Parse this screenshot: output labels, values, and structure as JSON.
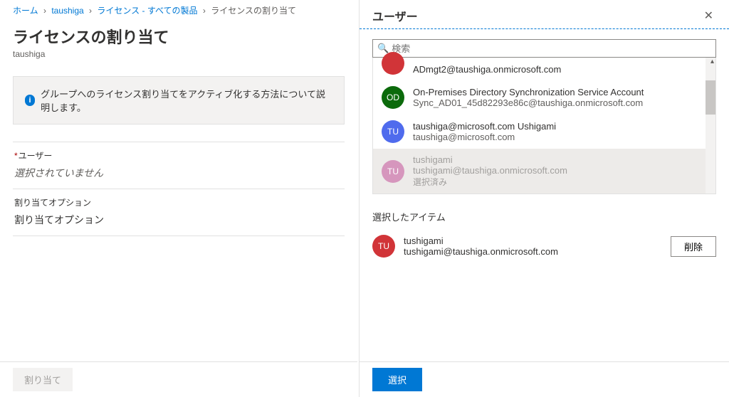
{
  "breadcrumbs": {
    "home": "ホーム",
    "tenant": "taushiga",
    "licenses": "ライセンス - すべての製品",
    "current": "ライセンスの割り当て"
  },
  "left": {
    "title": "ライセンスの割り当て",
    "subtitle": "taushiga",
    "info": "グループへのライセンス割り当てをアクティブ化する方法について説明します。",
    "user_label": "ユーザー",
    "user_placeholder": "選択されていません",
    "option_label": "割り当てオプション",
    "option_value": "割り当てオプション",
    "assign_button": "割り当て"
  },
  "blade": {
    "title": "ユーザー",
    "search_placeholder": "検索",
    "selected_header": "選択したアイテム",
    "remove_label": "削除",
    "select_button": "選択",
    "already_selected": "選択済み"
  },
  "users": {
    "0": {
      "initials": "",
      "color": "#d13438",
      "line1": "ADmgt2@taushiga.onmicrosoft.com",
      "line2": ""
    },
    "1": {
      "initials": "OD",
      "color": "#0b6a0b",
      "line1": "On-Premises Directory Synchronization Service Account",
      "line2": "Sync_AD01_45d82293e86c@taushiga.onmicrosoft.com"
    },
    "2": {
      "initials": "TU",
      "color": "#4f6bed",
      "line1": "taushiga@microsoft.com Ushigami",
      "line2": "taushiga@microsoft.com"
    },
    "3": {
      "initials": "TU",
      "color": "#d696bd",
      "line1": "tushigami",
      "line2": "tushigami@taushiga.onmicrosoft.com"
    }
  },
  "picked": {
    "initials": "TU",
    "color": "#d13438",
    "line1": "tushigami",
    "line2": "tushigami@taushiga.onmicrosoft.com"
  }
}
